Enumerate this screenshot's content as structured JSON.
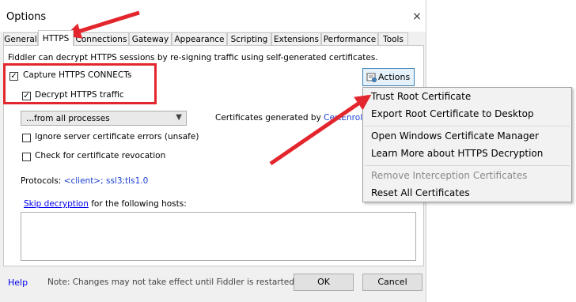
{
  "window": {
    "title": "Options",
    "close_glyph": "×"
  },
  "tabs": [
    {
      "label": "General"
    },
    {
      "label": "HTTPS"
    },
    {
      "label": "Connections"
    },
    {
      "label": "Gateway"
    },
    {
      "label": "Appearance"
    },
    {
      "label": "Scripting"
    },
    {
      "label": "Extensions"
    },
    {
      "label": "Performance"
    },
    {
      "label": "Tools"
    }
  ],
  "https": {
    "intro": "Fiddler can decrypt HTTPS sessions by re-signing traffic using self-generated certificates.",
    "capture_label": "Capture HTTPS CONNECTs",
    "capture_checked": true,
    "decrypt_label": "Decrypt HTTPS traffic",
    "decrypt_checked": true,
    "process_filter": "...from all processes",
    "ignore_errors_label": "Ignore server certificate errors (unsafe)",
    "revocation_label": "Check for certificate revocation",
    "protocols_label": "Protocols: ",
    "protocols_value": "<client>; ssl3;tls1.0",
    "certs_generated_label": "Certificates generated by ",
    "certs_generated_link": "CertEnroll e",
    "skip_link": "Skip decryption",
    "skip_rest": " for the following hosts:",
    "check_glyph": "✓"
  },
  "actions_button": {
    "label": "Actions"
  },
  "actions_menu": {
    "items": [
      {
        "label": "Trust Root Certificate",
        "enabled": true
      },
      {
        "label": "Export Root Certificate to Desktop",
        "enabled": true
      },
      {
        "label": "Open Windows Certificate Manager",
        "enabled": true
      },
      {
        "label": "Learn More about HTTPS Decryption",
        "enabled": true
      },
      {
        "label": "Remove Interception Certificates",
        "enabled": false
      },
      {
        "label": "Reset All Certificates",
        "enabled": true
      }
    ]
  },
  "footer": {
    "help": "Help",
    "note": "Note: Changes may not take effect until Fiddler is restarted.",
    "ok": "OK",
    "cancel": "Cancel"
  },
  "colors": {
    "annotation": "#e3262d",
    "link": "#0000ee",
    "disabled_text": "#8a8a8a"
  }
}
